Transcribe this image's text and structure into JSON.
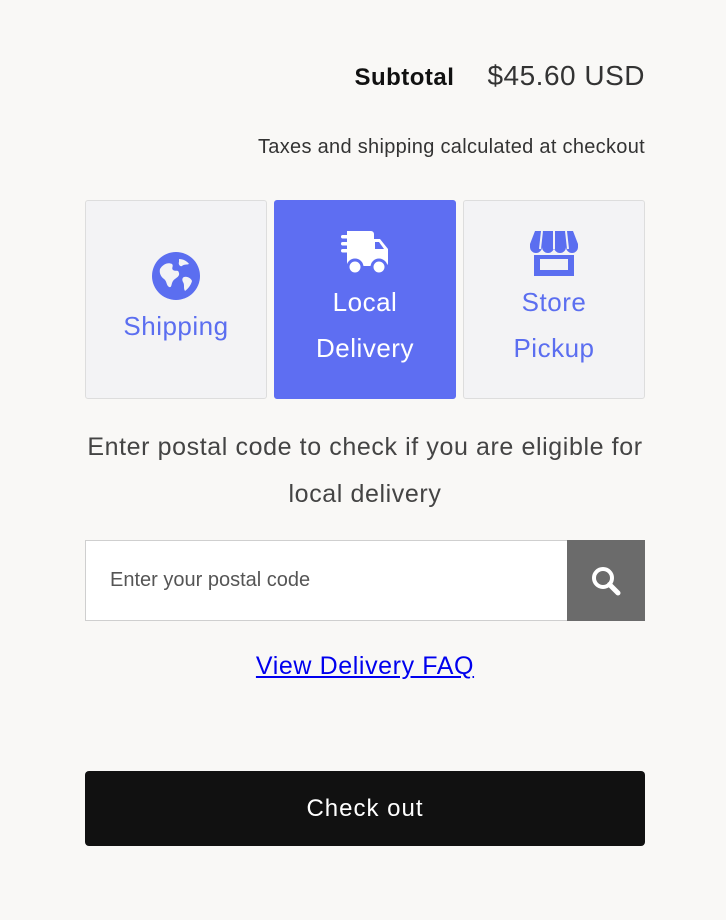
{
  "summary": {
    "subtotal_label": "Subtotal",
    "subtotal_value": "$45.60 USD",
    "tax_note": "Taxes and shipping calculated at checkout"
  },
  "delivery_options": [
    {
      "id": "shipping",
      "line1": "Shipping",
      "line2": "",
      "icon": "globe-icon",
      "selected": false
    },
    {
      "id": "local-delivery",
      "line1": "Local",
      "line2": "Delivery",
      "icon": "delivery-truck-icon",
      "selected": true
    },
    {
      "id": "store-pickup",
      "line1": "Store",
      "line2": "Pickup",
      "icon": "storefront-icon",
      "selected": false
    }
  ],
  "postal": {
    "prompt": "Enter postal code to check if you are eligible for local delivery",
    "placeholder": "Enter your postal code",
    "value": "",
    "search_icon": "search-icon"
  },
  "faq_link": "View Delivery FAQ",
  "checkout_label": "Check out",
  "colors": {
    "accent": "#5e6ef2",
    "option_bg": "#f3f3f5",
    "search_button": "#6b6b6b",
    "checkout_bg": "#111111",
    "link": "#0000ee",
    "page_bg": "#f9f8f6"
  }
}
